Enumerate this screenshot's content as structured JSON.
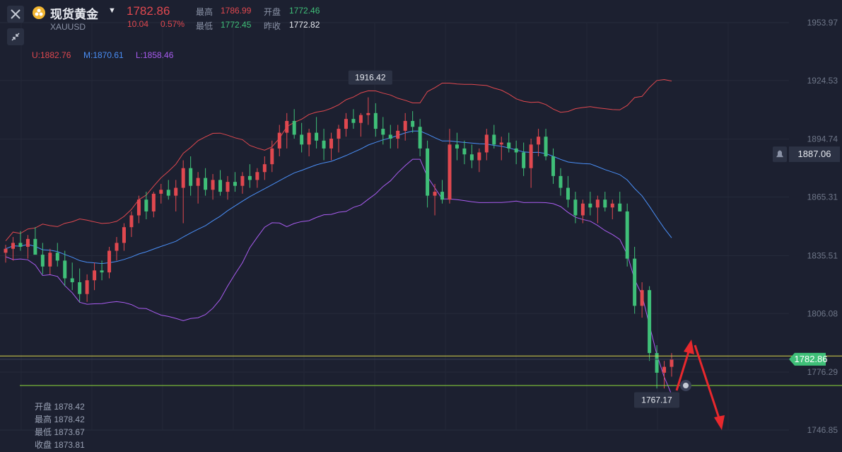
{
  "header": {
    "title": "现货黄金",
    "symbol": "XAUUSD",
    "price": "1782.86",
    "change": "10.04",
    "change_pct": "0.57%",
    "stats": [
      {
        "label": "最高",
        "value": "1786.99",
        "color": "#e0484f"
      },
      {
        "label": "开盘",
        "value": "1772.46",
        "color": "#3fbf78"
      },
      {
        "label": "最低",
        "value": "1772.45",
        "color": "#3fbf78"
      },
      {
        "label": "昨收",
        "value": "1772.82",
        "color": "#e8ebf1"
      }
    ]
  },
  "bollinger": {
    "upper": "U:1882.76",
    "middle": "M:1870.61",
    "lower": "L:1858.46",
    "colors": {
      "upper": "#e0484f",
      "middle": "#4a8ff7",
      "lower": "#a95cf0"
    }
  },
  "ohlc_panel": {
    "open_label": "开盘",
    "open": "1878.42",
    "high_label": "最高",
    "high": "1878.42",
    "low_label": "最低",
    "low": "1873.67",
    "close_label": "收盘",
    "close": "1873.81"
  },
  "icons": {
    "close": "close-icon",
    "shrink": "shrink-icon",
    "gold": "gold-coin-icon",
    "alert": "bell-icon",
    "dropdown": "chevron-down-icon"
  },
  "colors": {
    "up": "#e0484f",
    "down": "#3fbf78",
    "bg": "#1c2030",
    "yellow_line": "#d8d44a",
    "green_line": "#8edc3a"
  },
  "chart_data": {
    "type": "candlestick",
    "y_ticks": [
      "1953.97",
      "1924.53",
      "1894.74",
      "1865.31",
      "1835.51",
      "1806.08",
      "1776.29",
      "1746.85"
    ],
    "ylim": [
      1746.85,
      1953.97
    ],
    "alert_price": "1887.06",
    "current_price": "1782.86",
    "high_annotation": "1916.42",
    "low_annotation": "1767.17",
    "horizontal_lines": [
      1784.5,
      1769.5
    ],
    "candles": [
      [
        1837,
        1841,
        1832,
        1839
      ],
      [
        1839,
        1845,
        1833,
        1842
      ],
      [
        1842,
        1848,
        1838,
        1840
      ],
      [
        1840,
        1846,
        1834,
        1844
      ],
      [
        1844,
        1850,
        1838,
        1836
      ],
      [
        1836,
        1842,
        1826,
        1830
      ],
      [
        1830,
        1839,
        1826,
        1837
      ],
      [
        1837,
        1842,
        1830,
        1833
      ],
      [
        1833,
        1838,
        1820,
        1824
      ],
      [
        1824,
        1832,
        1818,
        1822
      ],
      [
        1822,
        1829,
        1812,
        1816
      ],
      [
        1816,
        1826,
        1812,
        1823
      ],
      [
        1823,
        1832,
        1818,
        1828
      ],
      [
        1828,
        1833,
        1823,
        1827
      ],
      [
        1827,
        1840,
        1824,
        1838
      ],
      [
        1838,
        1845,
        1833,
        1842
      ],
      [
        1842,
        1852,
        1838,
        1850
      ],
      [
        1850,
        1858,
        1845,
        1856
      ],
      [
        1856,
        1866,
        1852,
        1864
      ],
      [
        1864,
        1868,
        1854,
        1858
      ],
      [
        1858,
        1868,
        1855,
        1867
      ],
      [
        1867,
        1872,
        1862,
        1869
      ],
      [
        1869,
        1874,
        1864,
        1866
      ],
      [
        1866,
        1874,
        1858,
        1870
      ],
      [
        1870,
        1884,
        1852,
        1880
      ],
      [
        1880,
        1886,
        1866,
        1871
      ],
      [
        1871,
        1878,
        1862,
        1875
      ],
      [
        1875,
        1880,
        1866,
        1869
      ],
      [
        1869,
        1877,
        1864,
        1874
      ],
      [
        1874,
        1879,
        1866,
        1868
      ],
      [
        1868,
        1876,
        1864,
        1873
      ],
      [
        1873,
        1878,
        1868,
        1871
      ],
      [
        1871,
        1878,
        1867,
        1876
      ],
      [
        1876,
        1882,
        1870,
        1874
      ],
      [
        1874,
        1880,
        1870,
        1878
      ],
      [
        1878,
        1886,
        1874,
        1882
      ],
      [
        1882,
        1894,
        1878,
        1890
      ],
      [
        1890,
        1902,
        1886,
        1898
      ],
      [
        1898,
        1908,
        1890,
        1904
      ],
      [
        1904,
        1910,
        1895,
        1897
      ],
      [
        1897,
        1903,
        1888,
        1892
      ],
      [
        1892,
        1900,
        1886,
        1898
      ],
      [
        1898,
        1906,
        1890,
        1894
      ],
      [
        1894,
        1900,
        1884,
        1890
      ],
      [
        1890,
        1898,
        1884,
        1895
      ],
      [
        1895,
        1902,
        1888,
        1900
      ],
      [
        1900,
        1908,
        1896,
        1905
      ],
      [
        1905,
        1910,
        1900,
        1903
      ],
      [
        1903,
        1908,
        1896,
        1907
      ],
      [
        1907,
        1916,
        1902,
        1908
      ],
      [
        1908,
        1913,
        1896,
        1900
      ],
      [
        1900,
        1906,
        1892,
        1897
      ],
      [
        1897,
        1902,
        1890,
        1895
      ],
      [
        1895,
        1902,
        1890,
        1899
      ],
      [
        1899,
        1908,
        1894,
        1904
      ],
      [
        1904,
        1909,
        1898,
        1901
      ],
      [
        1901,
        1905,
        1886,
        1890
      ],
      [
        1890,
        1894,
        1860,
        1866
      ],
      [
        1866,
        1872,
        1856,
        1868
      ],
      [
        1868,
        1874,
        1862,
        1864
      ],
      [
        1864,
        1900,
        1862,
        1892
      ],
      [
        1892,
        1898,
        1884,
        1890
      ],
      [
        1890,
        1894,
        1882,
        1887
      ],
      [
        1887,
        1892,
        1880,
        1884
      ],
      [
        1884,
        1890,
        1878,
        1888
      ],
      [
        1888,
        1900,
        1884,
        1897
      ],
      [
        1897,
        1902,
        1890,
        1892
      ],
      [
        1892,
        1896,
        1884,
        1893
      ],
      [
        1893,
        1898,
        1888,
        1890
      ],
      [
        1890,
        1894,
        1882,
        1888
      ],
      [
        1888,
        1893,
        1876,
        1880
      ],
      [
        1880,
        1895,
        1870,
        1892
      ],
      [
        1892,
        1900,
        1886,
        1896
      ],
      [
        1896,
        1900,
        1884,
        1886
      ],
      [
        1886,
        1890,
        1872,
        1876
      ],
      [
        1876,
        1880,
        1866,
        1870
      ],
      [
        1870,
        1876,
        1860,
        1864
      ],
      [
        1864,
        1868,
        1852,
        1856
      ],
      [
        1856,
        1864,
        1852,
        1862
      ],
      [
        1862,
        1868,
        1856,
        1860
      ],
      [
        1860,
        1866,
        1852,
        1864
      ],
      [
        1864,
        1868,
        1858,
        1860
      ],
      [
        1860,
        1864,
        1854,
        1862
      ],
      [
        1862,
        1868,
        1858,
        1858
      ],
      [
        1858,
        1862,
        1830,
        1834
      ],
      [
        1834,
        1840,
        1806,
        1810
      ],
      [
        1810,
        1822,
        1804,
        1818
      ],
      [
        1818,
        1820,
        1782,
        1786
      ],
      [
        1786,
        1790,
        1768,
        1776
      ],
      [
        1776,
        1782,
        1768,
        1779
      ],
      [
        1779,
        1786,
        1774,
        1782.86
      ]
    ]
  }
}
